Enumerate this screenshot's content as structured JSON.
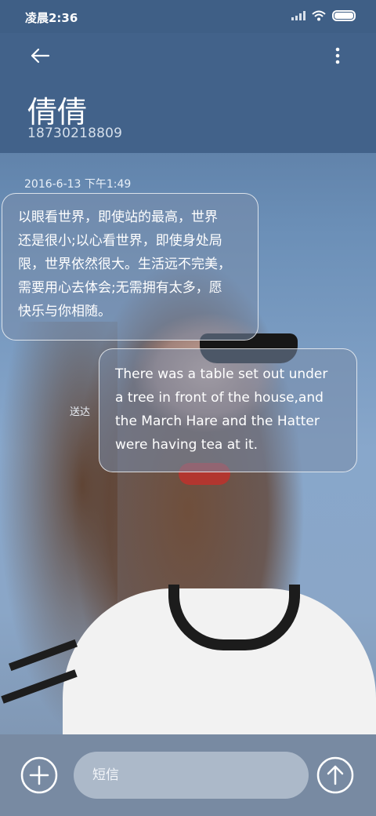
{
  "status_bar": {
    "time": "凌晨2:36"
  },
  "header": {
    "contact_name": "倩倩",
    "contact_number": "18730218809"
  },
  "messages": [
    {
      "direction": "incoming",
      "timestamp": "2016-6-13 下午1:49",
      "text": "以眼看世界，即使站的最高，世界\n还是很小;以心看世界，即使身处局\n限，世界依然很大。生活远不完美，\n需要用心去体会;无需拥有太多，愿\n快乐与你相随。"
    },
    {
      "direction": "outgoing",
      "status": "送达",
      "text": "There was a table set out under\na tree in front of the house,and\nthe March Hare and the Hatter\nwere having tea at it."
    }
  ],
  "composer": {
    "placeholder": "短信"
  },
  "icons": {
    "back": "arrow-left-icon",
    "more": "more-vertical-icon",
    "add": "plus-circle-icon",
    "send": "arrow-up-circle-icon"
  }
}
